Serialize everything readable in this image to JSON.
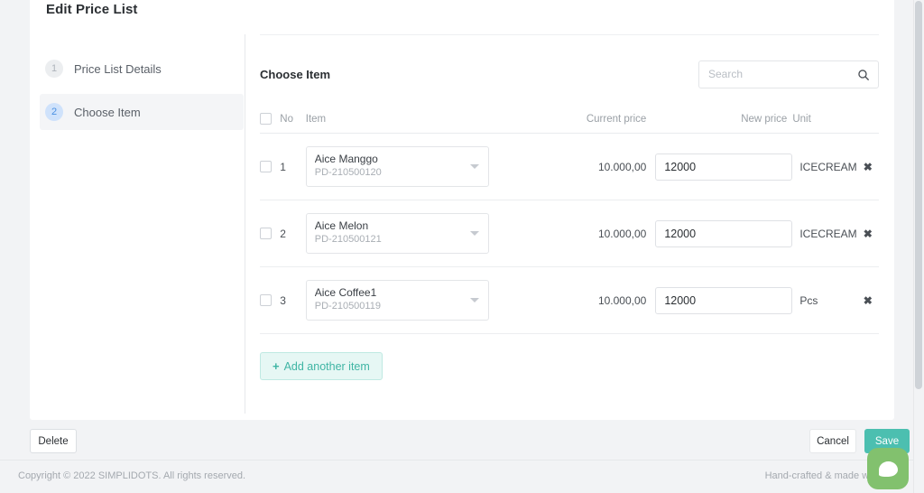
{
  "window": {
    "card_title": "Edit Price List"
  },
  "steps": [
    {
      "number": "1",
      "label": "Price List Details",
      "active": false
    },
    {
      "number": "2",
      "label": "Choose Item",
      "active": true
    }
  ],
  "panel": {
    "title": "Choose Item",
    "search": {
      "value": "",
      "placeholder": "Search",
      "icon": "search-icon"
    },
    "table": {
      "headers": {
        "no": "No",
        "item": "Item",
        "current_price": "Current price",
        "new_price": "New price",
        "unit": "Unit"
      },
      "rows": [
        {
          "no": "1",
          "item_name": "Aice Manggo",
          "item_code": "PD-210500120",
          "current_price": "10.000,00",
          "new_price": "12000",
          "unit": "ICECREAM",
          "remove_icon": "close-icon"
        },
        {
          "no": "2",
          "item_name": "Aice Melon",
          "item_code": "PD-210500121",
          "current_price": "10.000,00",
          "new_price": "12000",
          "unit": "ICECREAM",
          "remove_icon": "close-icon"
        },
        {
          "no": "3",
          "item_name": "Aice Coffee1",
          "item_code": "PD-210500119",
          "current_price": "10.000,00",
          "new_price": "12000",
          "unit": "Pcs",
          "remove_icon": "close-icon"
        }
      ]
    },
    "add_item_button": {
      "plus": "✛",
      "label": "Add another item"
    }
  },
  "action_bar": {
    "delete_label": "Delete",
    "cancel_label": "Cancel",
    "save_label": "Save"
  },
  "footer": {
    "copyright": "Copyright © 2022 SIMPLIDOTS. All rights reserved.",
    "credit": "Hand-crafted & made with love"
  },
  "chat": {
    "icon": "chat-bubble-icon"
  },
  "colors": {
    "save_teal": "#4cbfb0",
    "add_item_teal": "#3fb5a4",
    "chat_green": "#82c16e",
    "step_active_blue": "#4a90e2",
    "page_background": "#f2f3f5"
  }
}
